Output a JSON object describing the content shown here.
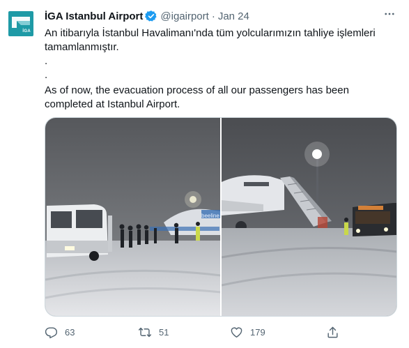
{
  "tweet": {
    "author_name": "İGA Istanbul Airport",
    "handle": "@igairport",
    "separator": "·",
    "date": "Jan 24",
    "avatar_text": "İGA",
    "text_tr_line1": "An itibarıyla İstanbul Havalimanı'nda tüm yolcularımızın tahliye işlemleri",
    "text_tr_line2": "tamamlanmıştır.",
    "dot1": ".",
    "dot2": ".",
    "text_en_line1": "As of now, the evacuation process of all our passengers has been",
    "text_en_line2": "completed at Istanbul Airport.",
    "bus_sign": "beeline",
    "replies": "63",
    "retweets": "51",
    "likes": "179"
  },
  "colors": {
    "brand": "#1e9aa6",
    "verified": "#1d9bf0",
    "secondary_text": "#536471"
  },
  "icons": [
    "verified-icon",
    "more-icon",
    "reply-icon",
    "retweet-icon",
    "like-icon",
    "share-icon"
  ]
}
